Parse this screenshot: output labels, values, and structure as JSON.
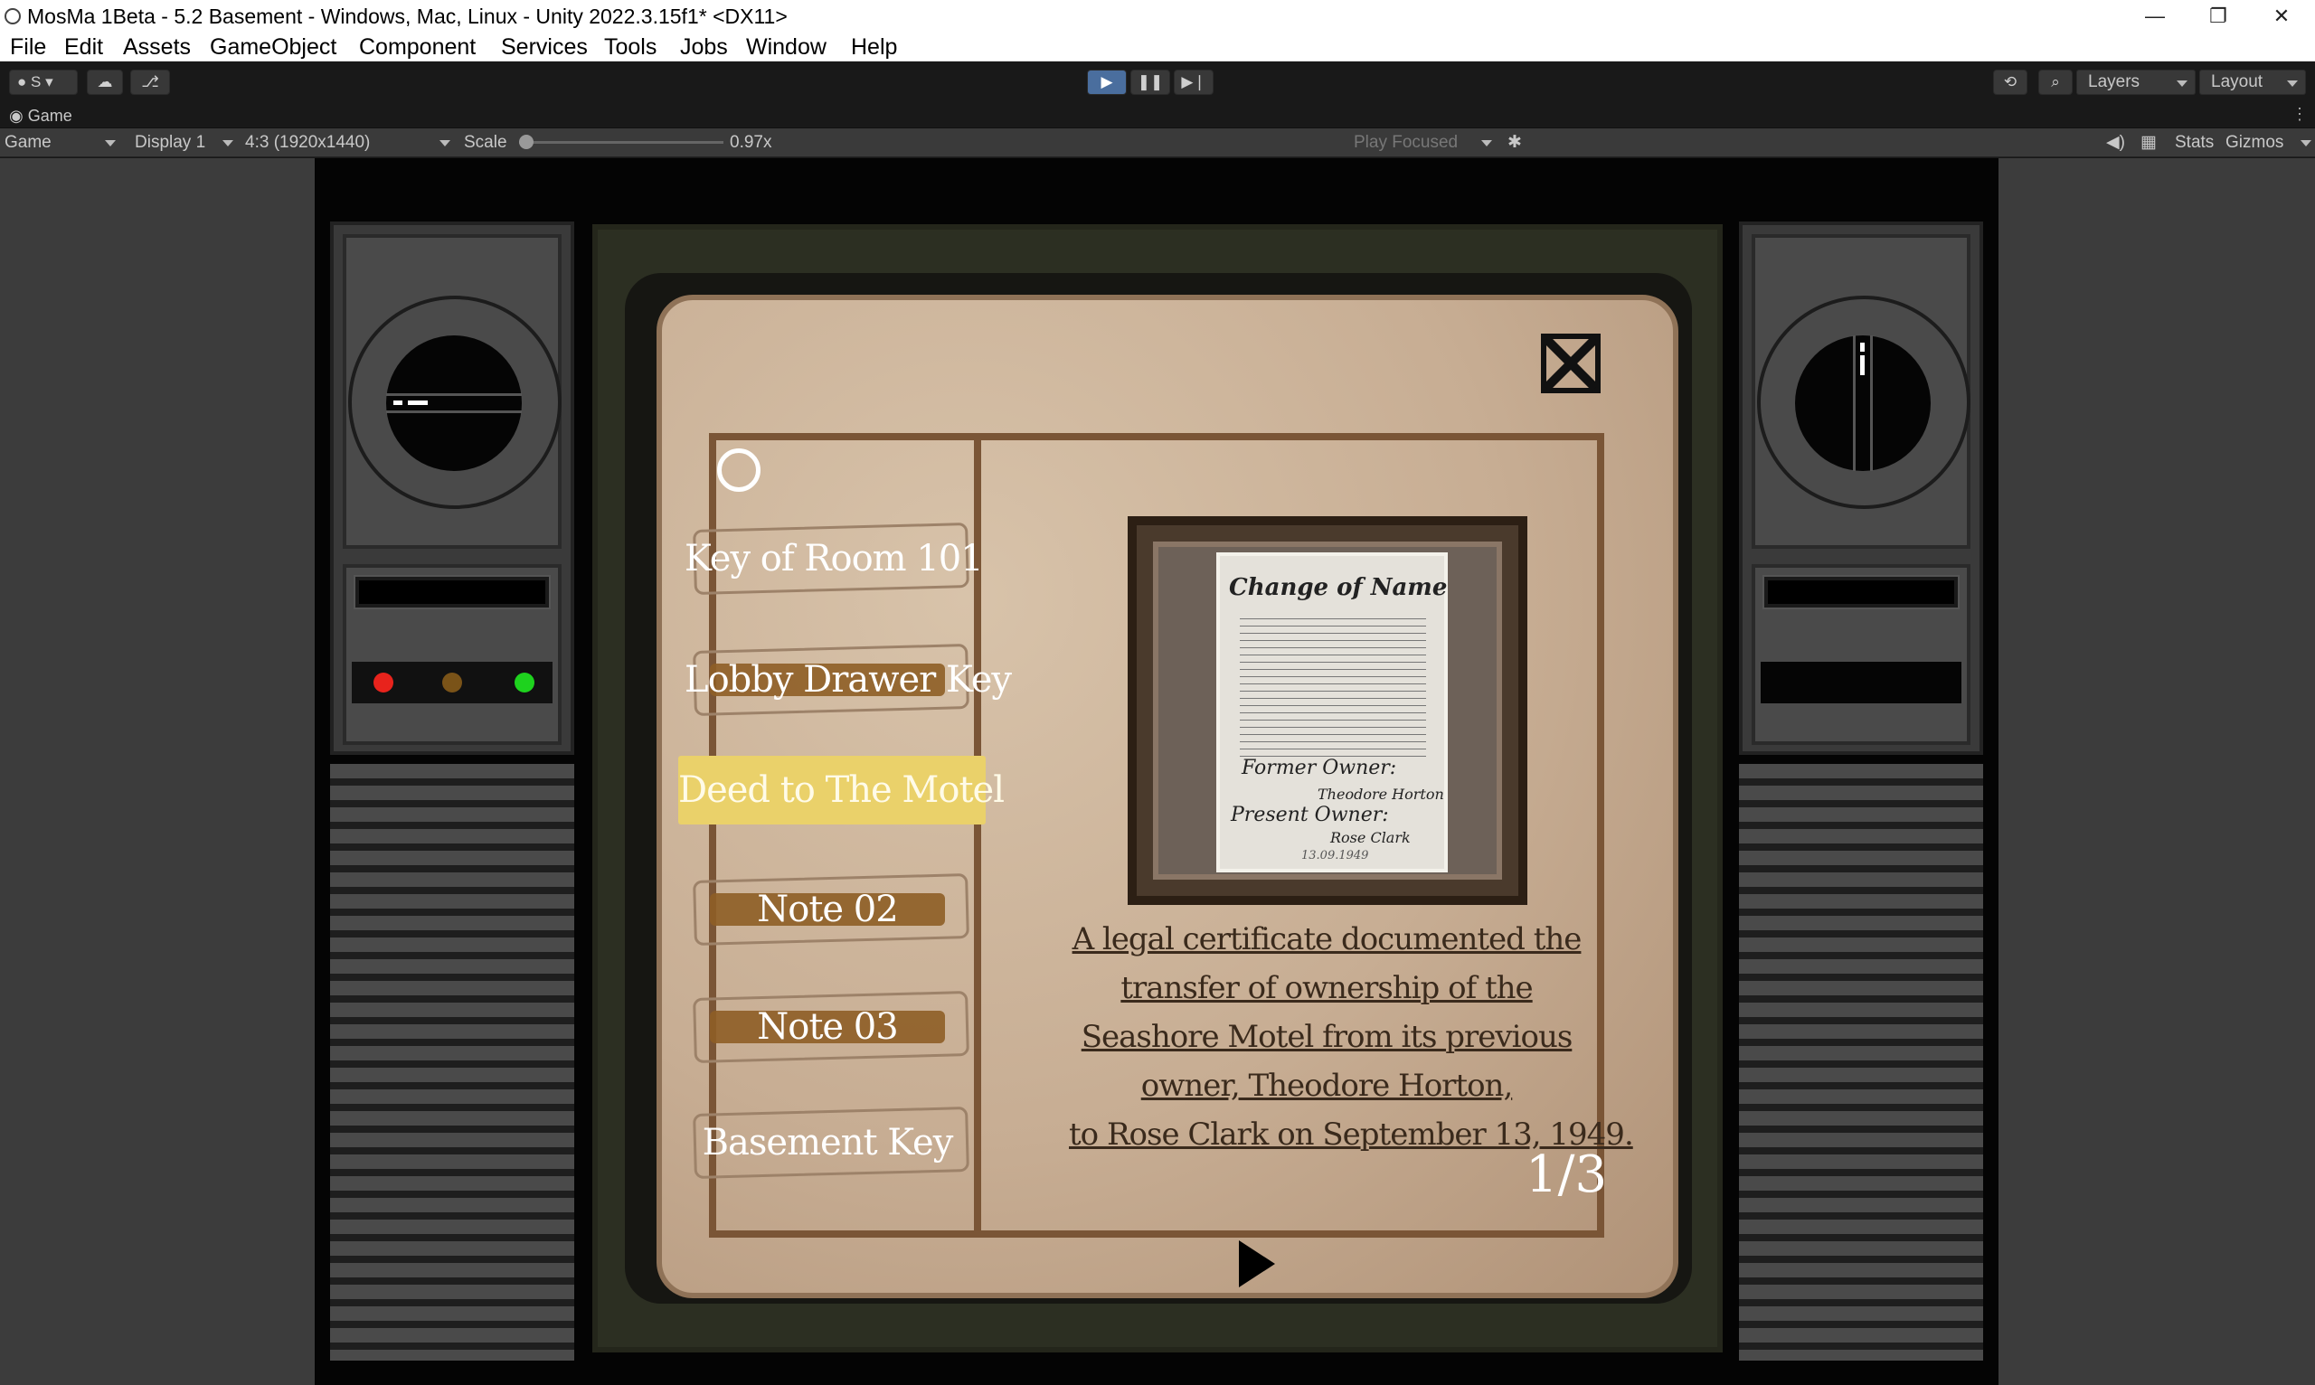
{
  "window": {
    "title": "MosMa 1Beta - 5.2 Basement - Windows, Mac, Linux - Unity 2022.3.15f1* <DX11>",
    "minimize": "—",
    "restore": "❐",
    "close": "✕"
  },
  "menu": [
    "File",
    "Edit",
    "Assets",
    "GameObject",
    "Component",
    "Services",
    "Tools",
    "Jobs",
    "Window",
    "Help"
  ],
  "toolbar": {
    "account_label": "S",
    "layers_label": "Layers",
    "layout_label": "Layout"
  },
  "game_tab": {
    "label": "Game"
  },
  "game_bar": {
    "mode": "Game",
    "display": "Display 1",
    "aspect": "4:3 (1920x1440)",
    "scale_label": "Scale",
    "scale_value": "0.97x",
    "play_focused": "Play Focused",
    "stats": "Stats",
    "gizmos": "Gizmos"
  },
  "inventory": {
    "items": [
      "Key of Room 101",
      "Lobby Drawer Key",
      "Deed to The Motel",
      "Note 02",
      "Note 03",
      "Basement Key"
    ],
    "selected_index": 2,
    "certificate": {
      "title": "Change of Name",
      "former_label": "Former Owner:",
      "former_name": "Theodore Horton",
      "present_label": "Present Owner:",
      "present_name": "Rose Clark",
      "date": "13.09.1949"
    },
    "description_lines": [
      "A legal certificate documented the",
      "transfer of ownership of the",
      "Seashore Motel from its previous",
      "owner, Theodore Horton,",
      "to Rose Clark on September 13, 1949."
    ],
    "pager": "1/3"
  },
  "colors": {
    "paper": "#c9b198",
    "highlight": "#ead16a",
    "item_bar": "#8e5e26",
    "lamp_red": "#e8231c",
    "lamp_amber": "#7a5318",
    "lamp_green": "#1ed21e"
  }
}
